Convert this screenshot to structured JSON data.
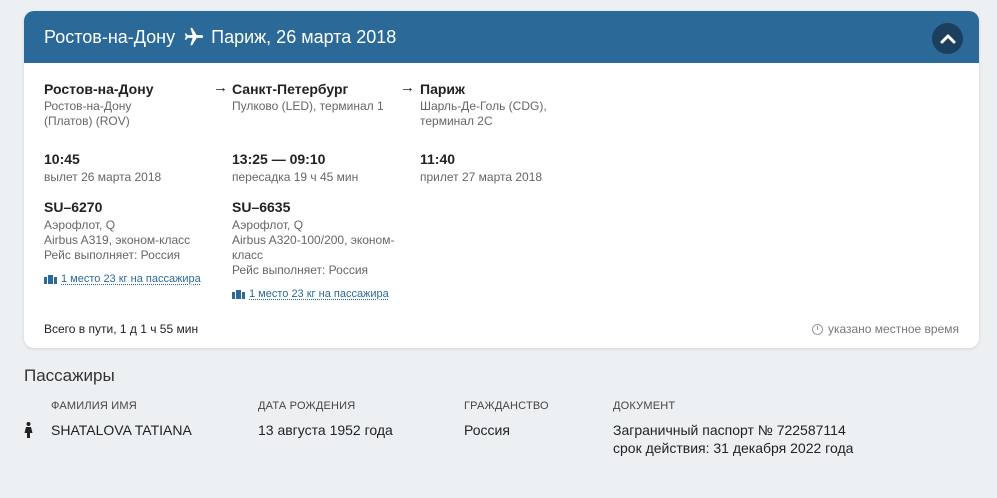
{
  "header": {
    "from": "Ростов-на-Дону",
    "to_date": "Париж, 26 марта 2018",
    "plane_icon": "plane-icon",
    "collapse_icon": "chevron-up-icon",
    "color": "#2b6a98"
  },
  "route": {
    "arrow": "→",
    "points": [
      {
        "city": "Ростов-на-Дону",
        "airport_line1": "Ростов-на-Дону",
        "airport_line2": "(Платов) (ROV)",
        "time": "10:45",
        "time_note": "вылет 26 марта 2018"
      },
      {
        "city": "Санкт-Петербург",
        "airport_line1": "Пулково (LED), терминал 1",
        "airport_line2": "",
        "time": "13:25 — 09:10",
        "time_note": "пересадка 19 ч 45 мин"
      },
      {
        "city": "Париж",
        "airport_line1": "Шарль-Де-Голь (CDG),",
        "airport_line2": "терминал 2С",
        "time": "11:40",
        "time_note": "прилет 27 марта 2018"
      }
    ],
    "flights": [
      {
        "number": "SU–6270",
        "line1": "Аэрофлот, Q",
        "line2": "Airbus A319, эконом-класс",
        "line3": "Рейс выполняет: Россия",
        "line4": "",
        "baggage": "1 место 23 кг на пассажира"
      },
      {
        "number": "SU–6635",
        "line1": "Аэрофлот, Q",
        "line2": "Airbus A320-100/200, эконом-",
        "line3": "класс",
        "line4": "Рейс выполняет: Россия",
        "baggage": "1 место 23 кг на пассажира"
      }
    ],
    "total": "Всего в пути, 1 д 1 ч 55 мин",
    "local_time_note": "указано местное время"
  },
  "passengers": {
    "title": "Пассажиры",
    "columns": [
      "ФАМИЛИЯ ИМЯ",
      "ДАТА РОЖДЕНИЯ",
      "ГРАЖДАНСТВО",
      "ДОКУМЕНТ"
    ],
    "rows": [
      {
        "name": "SHATALOVA TATIANA",
        "birth": "13 августа 1952 года",
        "citizenship": "Россия",
        "document_line1": "Заграничный паспорт № 722587114",
        "document_line2": "срок действия: 31 декабря 2022 года"
      }
    ]
  }
}
